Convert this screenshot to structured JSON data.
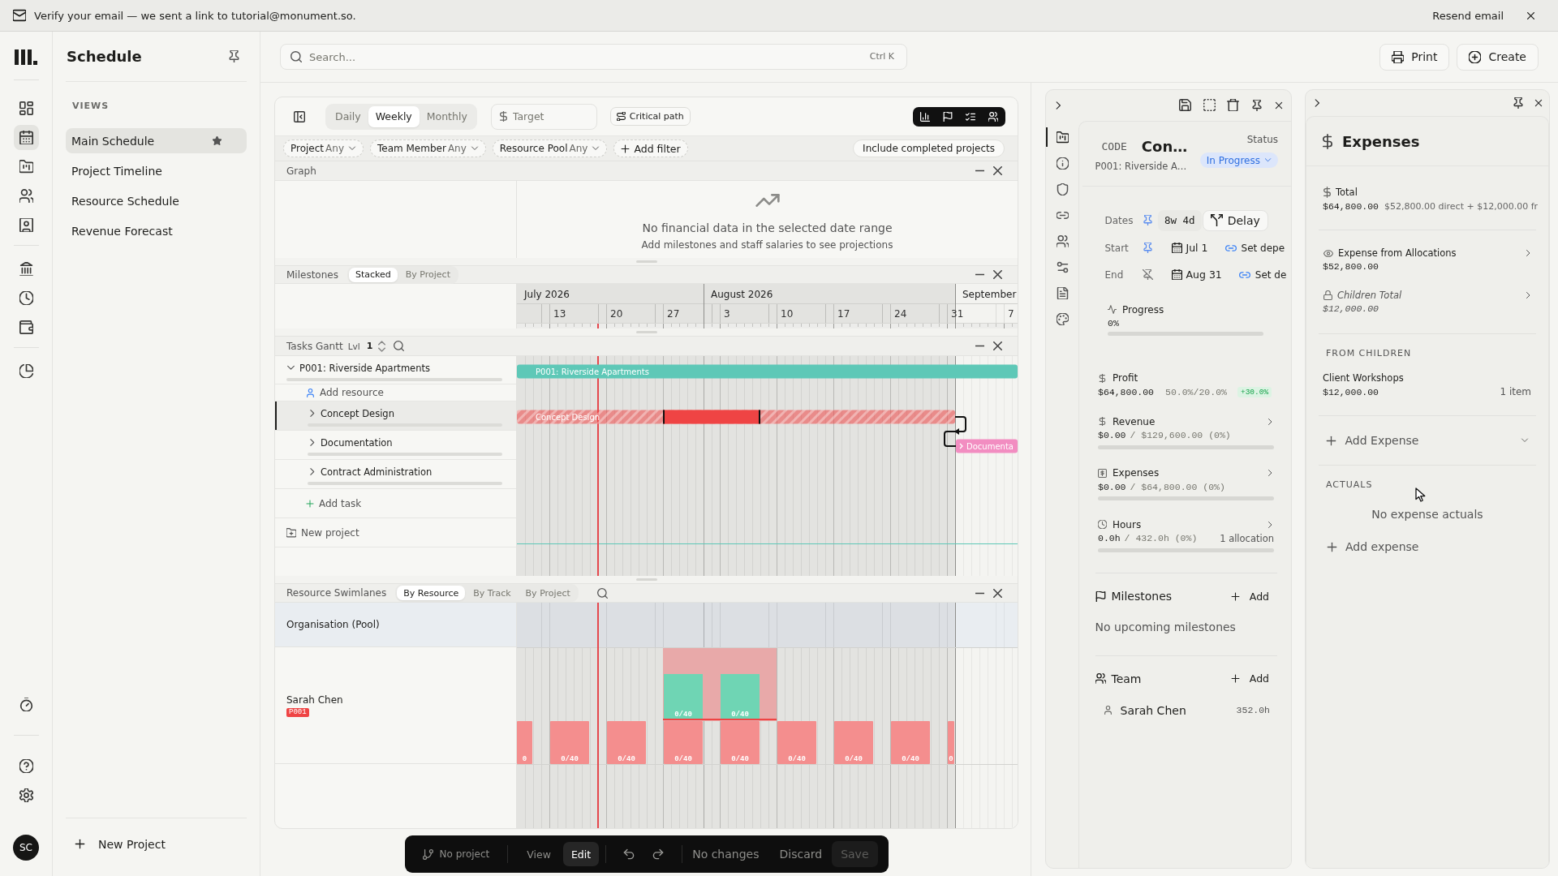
{
  "banner": {
    "message": "Verify your email — we sent a link to tutorial@monument.so.",
    "action": "Resend email"
  },
  "nav_rail": {
    "top_groups": [
      {
        "items": [
          {
            "selected": false
          },
          {
            "selected": true
          },
          {
            "selected": false
          },
          {
            "selected": false
          },
          {
            "selected": false
          }
        ]
      },
      {
        "items": [
          {
            "selected": false
          },
          {
            "selected": false
          },
          {
            "selected": false
          }
        ]
      },
      {
        "items": [
          {
            "selected": false
          }
        ]
      }
    ],
    "bottom_groups": [
      {
        "items": [
          {
            "selected": false
          }
        ]
      },
      {
        "items": [
          {
            "selected": false
          },
          {
            "selected": false
          }
        ]
      }
    ],
    "avatar": "SC"
  },
  "sidebar": {
    "title": "Schedule",
    "section": "VIEWS",
    "views": [
      {
        "label": "Main Schedule",
        "selected": true,
        "starred": true
      },
      {
        "label": "Project Timeline",
        "selected": false,
        "starred": false
      },
      {
        "label": "Resource Schedule",
        "selected": false,
        "starred": false
      },
      {
        "label": "Revenue Forecast",
        "selected": false,
        "starred": false
      }
    ],
    "new_project": "New Project"
  },
  "header": {
    "search": {
      "placeholder": "Search...",
      "shortcut": "Ctrl K"
    },
    "buttons": [
      {
        "label": "Print"
      },
      {
        "label": "Create"
      }
    ]
  },
  "schedule": {
    "scales": [
      {
        "label": "Daily",
        "selected": false
      },
      {
        "label": "Weekly",
        "selected": true
      },
      {
        "label": "Monthly",
        "selected": false
      }
    ],
    "target": {
      "placeholder": "Target"
    },
    "critical_path": "Critical path",
    "filters": [
      {
        "label": "Project",
        "value": "Any"
      },
      {
        "label": "Team Member",
        "value": "Any"
      },
      {
        "label": "Resource Pool",
        "value": "Any"
      }
    ],
    "add_filter": "Add filter",
    "include_completed": "Include completed projects",
    "graph": {
      "title": "Graph",
      "empty_title": "No financial data in the selected date range",
      "empty_hint": "Add milestones and staff salaries to see projections"
    },
    "milestones": {
      "title": "Milestones",
      "modes": [
        {
          "label": "Stacked",
          "selected": true
        },
        {
          "label": "By Project",
          "selected": false
        }
      ]
    },
    "timeline": {
      "months": [
        "July 2026",
        "August 2026",
        "September"
      ],
      "weeks": [
        "13",
        "20",
        "27",
        "3",
        "10",
        "17",
        "24",
        "31",
        "7"
      ]
    },
    "tasks": {
      "title": "Tasks Gantt",
      "level_label": "Lvl",
      "level_value": "1",
      "rows": [
        {
          "kind": "project",
          "name": "P001: Riverside Apartments",
          "expanded": true,
          "selected": false,
          "level": 0,
          "bar": {
            "kind": "solid",
            "color": "#5ec8b7",
            "label": "P001: Riverside Apartments",
            "linked": false
          }
        },
        {
          "kind": "add_resource",
          "name": "Add resource"
        },
        {
          "kind": "task",
          "name": "Concept Design",
          "expanded": false,
          "selected": true,
          "level": 0,
          "bar": {
            "kind": "striped",
            "color": "#ef4444",
            "label": "Concept Design",
            "linked": false
          }
        },
        {
          "kind": "task",
          "name": "Documentation",
          "expanded": false,
          "selected": false,
          "level": 0,
          "bar": {
            "kind": "solid",
            "color": "#f28dc1",
            "label": "Documenta",
            "linked": true
          }
        },
        {
          "kind": "task",
          "name": "Contract Administration",
          "expanded": false,
          "selected": false,
          "level": 0
        },
        {
          "kind": "add_task",
          "name": "Add task"
        },
        {
          "kind": "new_project",
          "name": "New project"
        }
      ]
    },
    "swimlanes": {
      "title": "Resource Swimlanes",
      "modes": [
        {
          "label": "By Resource",
          "selected": true
        },
        {
          "label": "By Track",
          "selected": false
        },
        {
          "label": "By Project",
          "selected": false
        }
      ],
      "rows": [
        {
          "kind": "pool",
          "name": "Organisation (Pool)"
        },
        {
          "kind": "person",
          "name": "Sarah Chen",
          "tag": "P001",
          "capacity": [
            "0",
            "0/40",
            "0/40",
            "0/40",
            "0/40",
            "0/40",
            "0/40",
            "0/40",
            "0"
          ],
          "allocations": [
            "0/40",
            "0/40"
          ]
        }
      ]
    }
  },
  "bottom_bar": {
    "branch": "No project",
    "modes": [
      {
        "label": "View",
        "selected": false
      },
      {
        "label": "Edit",
        "selected": true
      }
    ],
    "status": "No changes",
    "discard": "Discard",
    "save": {
      "label": "Save",
      "disabled": true
    }
  },
  "detail": {
    "tabs": [
      {
        "selected": true
      },
      {
        "selected": false
      },
      {
        "selected": false
      },
      {
        "selected": false
      },
      {
        "selected": false
      },
      {
        "selected": false
      },
      {
        "selected": false
      },
      {
        "selected": false
      }
    ],
    "code_label": "CODE",
    "title": "Con…",
    "subtitle": "P001: Riverside A…",
    "status_label": "Status",
    "status": "In Progress",
    "dates": {
      "label": "Dates",
      "pinned": true,
      "duration": "8w 4d",
      "action": "Delay"
    },
    "start": {
      "label": "Start",
      "pinned": true,
      "date": "Jul 1",
      "dependency": "Set depe"
    },
    "end": {
      "label": "End",
      "pinned": false,
      "date": "Aug 31",
      "dependency": "Set de"
    },
    "progress": {
      "label": "Progress",
      "value": "0%",
      "level": 0
    },
    "profit": {
      "label": "Profit",
      "amount": "$64,800.00",
      "ratio": "50.0%/20.0%",
      "delta": "+30.0%"
    },
    "metrics": [
      {
        "label": "Revenue",
        "value": "$0.00",
        "total": "/ $129,600.00 (0%)",
        "level": 0
      },
      {
        "label": "Expenses",
        "value": "$0.00",
        "total": "/ $64,800.00 (0%)",
        "level": 0
      },
      {
        "label": "Hours",
        "value": "0.0h",
        "total": "/ 432.0h (0%)",
        "note": "1 allocation",
        "level": 0
      }
    ],
    "milestones": {
      "title": "Milestones",
      "add": "Add",
      "empty": "No upcoming milestones"
    },
    "team": {
      "title": "Team",
      "add": "Add",
      "members": [
        {
          "name": "Sarah Chen",
          "hours": "352.0h"
        }
      ]
    }
  },
  "expenses": {
    "title": "Expenses",
    "total": {
      "label": "Total",
      "amount": "$64,800.00",
      "breakdown": "$52,800.00 direct + $12,000.00 fr"
    },
    "sources": [
      {
        "kind": "allocations",
        "label": "Expense from Allocations",
        "amount": "$52,800.00"
      },
      {
        "kind": "children",
        "label": "Children Total",
        "amount": "$12,000.00"
      }
    ],
    "children_heading": "FROM CHILDREN",
    "children": [
      {
        "name": "Client Workshops",
        "amount": "$12,000.00",
        "count": "1 item"
      }
    ],
    "add_expense": "Add Expense",
    "actuals_heading": "ACTUALS",
    "actuals_empty": "No expense actuals",
    "add_actual": "Add expense"
  }
}
